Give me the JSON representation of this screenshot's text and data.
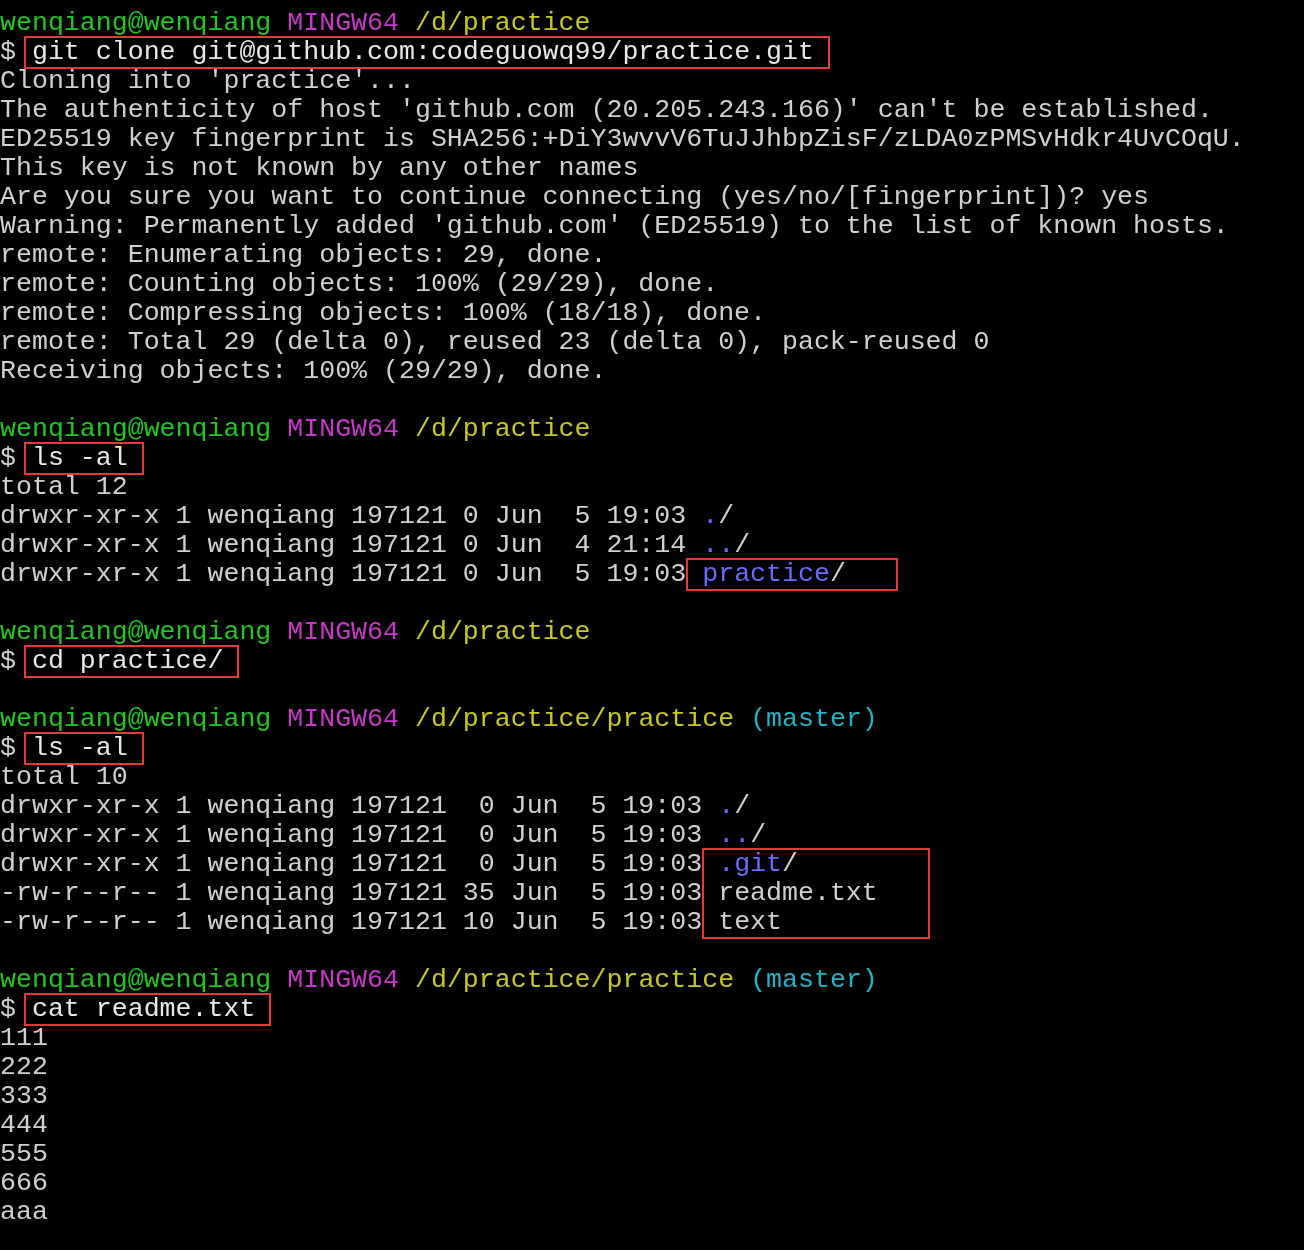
{
  "terminal": {
    "blocks": [
      {
        "prompt": {
          "user_host": "wenqiang@wenqiang",
          "system": "MINGW64",
          "path": "/d/practice"
        },
        "symbol": "$",
        "command": {
          "text": "git clone git@github.com:codeguowq99/practice.git",
          "boxed": true
        },
        "output": [
          "Cloning into 'practice'...",
          "The authenticity of host 'github.com (20.205.243.166)' can't be established.",
          "ED25519 key fingerprint is SHA256:+DiY3wvvV6TuJJhbpZisF/zLDA0zPMSvHdkr4UvCOqU.",
          "This key is not known by any other names",
          "Are you sure you want to continue connecting (yes/no/[fingerprint])? yes",
          "Warning: Permanently added 'github.com' (ED25519) to the list of known hosts.",
          "remote: Enumerating objects: 29, done.",
          "remote: Counting objects: 100% (29/29), done.",
          "remote: Compressing objects: 100% (18/18), done.",
          "remote: Total 29 (delta 0), reused 23 (delta 0), pack-reused 0",
          "Receiving objects: 100% (29/29), done."
        ]
      },
      {
        "prompt": {
          "user_host": "wenqiang@wenqiang",
          "system": "MINGW64",
          "path": "/d/practice"
        },
        "symbol": "$",
        "command": {
          "text": "ls -al",
          "boxed": true
        },
        "output": [
          "total 12"
        ],
        "listing": [
          {
            "details": "drwxr-xr-x 1 wenqiang 197121 0 Jun  5 19:03",
            "name": ".",
            "suffix": "/",
            "kind": "dir",
            "boxed": false
          },
          {
            "details": "drwxr-xr-x 1 wenqiang 197121 0 Jun  4 21:14",
            "name": "..",
            "suffix": "/",
            "kind": "dir",
            "boxed": false
          },
          {
            "details": "drwxr-xr-x 1 wenqiang 197121 0 Jun  5 19:03",
            "name": "practice",
            "suffix": "/",
            "kind": "dir",
            "boxed": true
          }
        ]
      },
      {
        "prompt": {
          "user_host": "wenqiang@wenqiang",
          "system": "MINGW64",
          "path": "/d/practice"
        },
        "symbol": "$",
        "command": {
          "text": "cd practice/",
          "boxed": true
        }
      },
      {
        "prompt": {
          "user_host": "wenqiang@wenqiang",
          "system": "MINGW64",
          "path": "/d/practice/practice",
          "branch": "(master)"
        },
        "symbol": "$",
        "command": {
          "text": "ls -al",
          "boxed": true
        },
        "output": [
          "total 10"
        ],
        "listing": [
          {
            "details": "drwxr-xr-x 1 wenqiang 197121  0 Jun  5 19:03",
            "name": ".",
            "suffix": "/",
            "kind": "dir",
            "boxed": false
          },
          {
            "details": "drwxr-xr-x 1 wenqiang 197121  0 Jun  5 19:03",
            "name": "..",
            "suffix": "/",
            "kind": "dir",
            "boxed": false
          },
          {
            "details": "drwxr-xr-x 1 wenqiang 197121  0 Jun  5 19:03",
            "name": ".git",
            "suffix": "/",
            "kind": "dir",
            "boxed": true
          },
          {
            "details": "-rw-r--r-- 1 wenqiang 197121 35 Jun  5 19:03",
            "name": "readme.txt",
            "kind": "file",
            "boxed": true
          },
          {
            "details": "-rw-r--r-- 1 wenqiang 197121 10 Jun  5 19:03",
            "name": "text",
            "kind": "file",
            "boxed": true
          }
        ]
      },
      {
        "prompt": {
          "user_host": "wenqiang@wenqiang",
          "system": "MINGW64",
          "path": "/d/practice/practice",
          "branch": "(master)"
        },
        "symbol": "$",
        "command": {
          "text": "cat readme.txt",
          "boxed": true
        },
        "output": [
          "111",
          "222",
          "333",
          "444",
          "555",
          "666",
          "aaa"
        ]
      }
    ]
  }
}
